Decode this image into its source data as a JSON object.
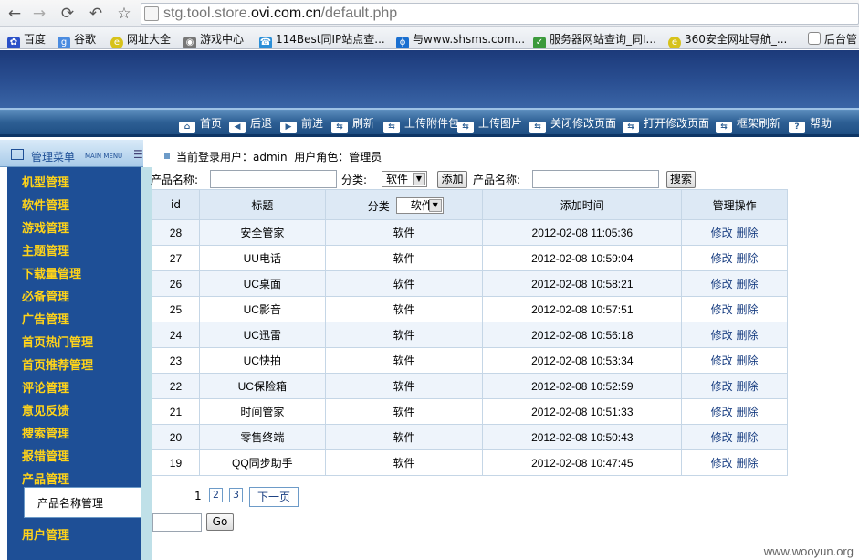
{
  "browser": {
    "url_prefix": "stg.tool.store.",
    "url_domain": "ovi.com.cn",
    "url_path": "/default.php",
    "bookmarks": [
      "百度",
      "谷歌",
      "网址大全",
      "游戏中心",
      "114Best同IP站点查...",
      "与www.shsms.com...",
      "服务器网站查询_同I...",
      "360安全网址导航_...",
      "后台管"
    ]
  },
  "toolbar": {
    "items": [
      "首页",
      "后退",
      "前进",
      "刷新",
      "上传附件包",
      "上传图片",
      "关闭修改页面",
      "打开修改页面",
      "框架刷新",
      "帮助"
    ]
  },
  "sidebar": {
    "title": "管理菜单",
    "title_en": "MAIN MENU",
    "items": [
      "机型管理",
      "软件管理",
      "游戏管理",
      "主题管理",
      "下载量管理",
      "必备管理",
      "广告管理",
      "首页热门管理",
      "首页推荐管理",
      "评论管理",
      "意见反馈",
      "搜索管理",
      "报错管理",
      "产品管理"
    ],
    "sub_item": "产品名称管理",
    "last_item": "用户管理"
  },
  "user_line": {
    "label": "当前登录用户：",
    "user": "admin",
    "role_label": "用户角色：",
    "role": "管理员"
  },
  "filter": {
    "name_label": "产品名称:",
    "name_value": "",
    "category_label": "分类:",
    "category_value": "软件",
    "add_button": "添加",
    "search_label": "产品名称:",
    "search_value": "",
    "search_button": "搜索"
  },
  "table": {
    "headers": [
      "id",
      "标题",
      "分类",
      "添加时间",
      "管理操作"
    ],
    "header_category_select": "软件",
    "edit_label": "修改",
    "delete_label": "删除",
    "rows": [
      {
        "id": "28",
        "title": "安全管家",
        "category": "软件",
        "time": "2012-02-08 11:05:36"
      },
      {
        "id": "27",
        "title": "UU电话",
        "category": "软件",
        "time": "2012-02-08 10:59:04"
      },
      {
        "id": "26",
        "title": "UC桌面",
        "category": "软件",
        "time": "2012-02-08 10:58:21"
      },
      {
        "id": "25",
        "title": "UC影音",
        "category": "软件",
        "time": "2012-02-08 10:57:51"
      },
      {
        "id": "24",
        "title": "UC迅雷",
        "category": "软件",
        "time": "2012-02-08 10:56:18"
      },
      {
        "id": "23",
        "title": "UC快拍",
        "category": "软件",
        "time": "2012-02-08 10:53:34"
      },
      {
        "id": "22",
        "title": "UC保险箱",
        "category": "软件",
        "time": "2012-02-08 10:52:59"
      },
      {
        "id": "21",
        "title": "时间管家",
        "category": "软件",
        "time": "2012-02-08 10:51:33"
      },
      {
        "id": "20",
        "title": "零售终端",
        "category": "软件",
        "time": "2012-02-08 10:50:43"
      },
      {
        "id": "19",
        "title": "QQ同步助手",
        "category": "软件",
        "time": "2012-02-08 10:47:45"
      }
    ]
  },
  "pager": {
    "current": "1",
    "pages": [
      "2",
      "3"
    ],
    "next": "下一页",
    "go_value": "",
    "go_button": "Go"
  },
  "watermark": "www.wooyun.org"
}
